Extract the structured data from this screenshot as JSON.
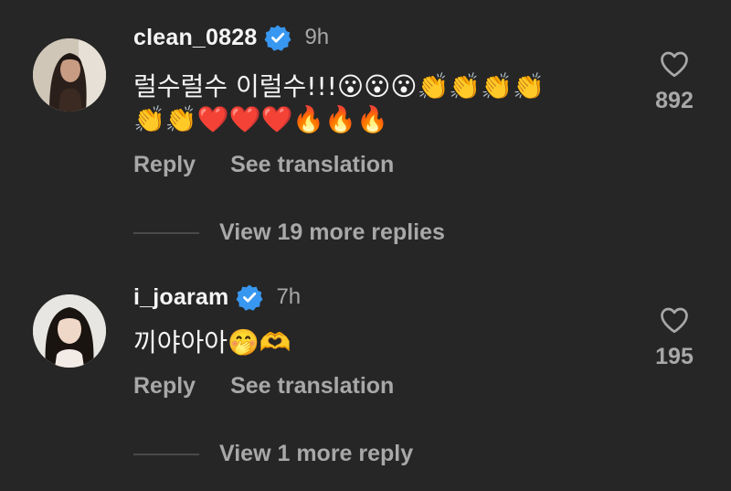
{
  "comments": [
    {
      "username": "clean_0828",
      "time": "9h",
      "text_line1": "럴수럴수 이럴수!!!😮😮😮👏👏👏👏",
      "text_line2": "👏👏❤️❤️❤️🔥🔥🔥",
      "reply_label": "Reply",
      "translate_label": "See translation",
      "like_count": "892",
      "more_replies": "View 19 more replies",
      "avatar_icon": "profile-photo-icon",
      "verified_icon": "verified-badge-icon"
    },
    {
      "username": "i_joaram",
      "time": "7h",
      "text_line1": "끼야아아🤭🫶",
      "reply_label": "Reply",
      "translate_label": "See translation",
      "like_count": "195",
      "more_replies": "View 1 more reply",
      "avatar_icon": "profile-photo-icon",
      "verified_icon": "verified-badge-icon"
    }
  ],
  "colors": {
    "background": "#262626",
    "primary_text": "#f5f5f5",
    "secondary_text": "#a8a8a8",
    "verified_blue": "#3897f0"
  }
}
